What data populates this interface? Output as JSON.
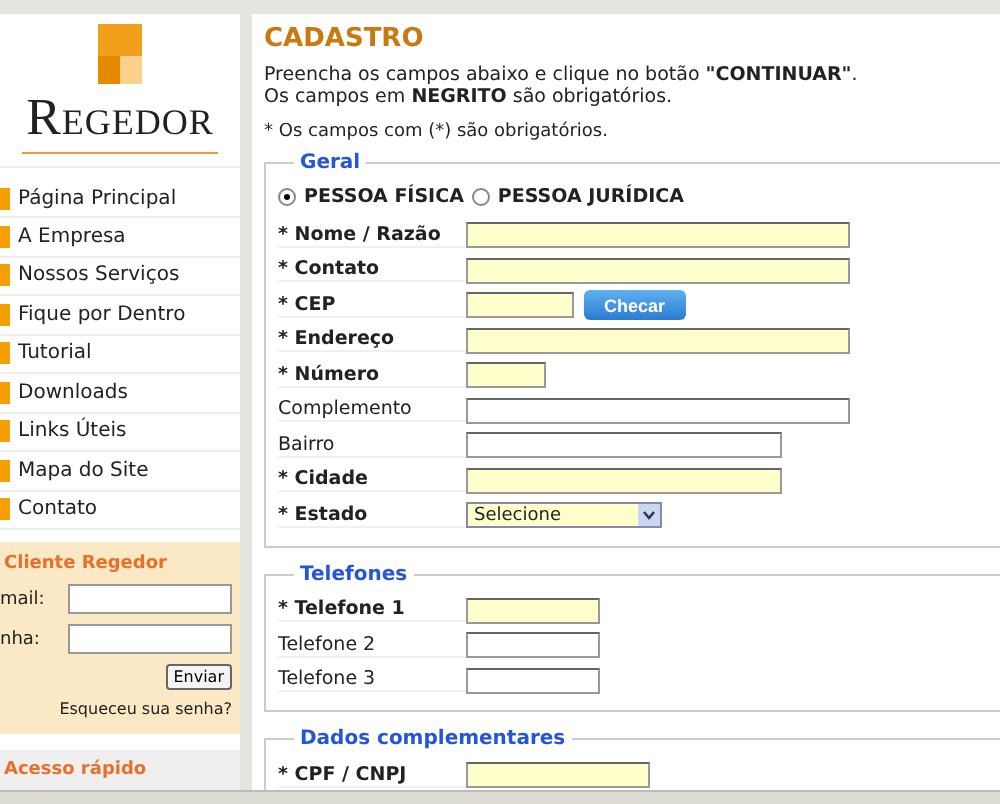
{
  "logo": {
    "text": "Regedor"
  },
  "menu": [
    {
      "label": "Página Principal"
    },
    {
      "label": "A Empresa"
    },
    {
      "label": "Nossos Serviços"
    },
    {
      "label": "Fique por Dentro"
    },
    {
      "label": "Tutorial"
    },
    {
      "label": "Downloads"
    },
    {
      "label": "Links Úteis"
    },
    {
      "label": "Mapa do Site"
    },
    {
      "label": "Contato"
    }
  ],
  "client_login": {
    "title": "Cliente Regedor",
    "fields": [
      {
        "label": "mail:"
      },
      {
        "label": "nha:"
      }
    ],
    "button": "Enviar",
    "forgot_link": "Esqueceu sua senha?"
  },
  "quick_access": {
    "title": "Acesso rápido"
  },
  "page": {
    "title": "CADASTRO",
    "intro": "Preencha os campos abaixo e clique no botão **\"CONTINUAR\"**.",
    "intro2": "Os campos em **NEGRITO** são obrigatórios.",
    "note": "* Os campos com (*) são obrigatórios."
  },
  "sections": [
    {
      "title": "Geral",
      "person_types": [
        {
          "label": "PESSOA FÍSICA",
          "selected": true
        },
        {
          "label": "PESSOA JURÍDICA",
          "selected": false
        }
      ],
      "fields": [
        {
          "label": "* Nome / Razão",
          "required": true,
          "kind": "text"
        },
        {
          "label": "* Contato",
          "required": true,
          "kind": "text"
        },
        {
          "label": "* CEP",
          "required": true,
          "kind": "text",
          "button": "Checar"
        },
        {
          "label": "* Endereço",
          "required": true,
          "kind": "text"
        },
        {
          "label": "* Número",
          "required": true,
          "kind": "text"
        },
        {
          "label": "Complemento",
          "required": false,
          "kind": "text"
        },
        {
          "label": "Bairro",
          "required": false,
          "kind": "text"
        },
        {
          "label": "* Cidade",
          "required": true,
          "kind": "text"
        },
        {
          "label": "* Estado",
          "required": true,
          "kind": "select",
          "value": "Selecione"
        }
      ]
    },
    {
      "title": "Telefones",
      "fields": [
        {
          "label": "* Telefone 1",
          "required": true,
          "kind": "text"
        },
        {
          "label": "Telefone 2",
          "required": false,
          "kind": "text"
        },
        {
          "label": "Telefone 3",
          "required": false,
          "kind": "text"
        }
      ]
    },
    {
      "title": "Dados complementares",
      "fields": [
        {
          "label": "* CPF / CNPJ",
          "required": true,
          "kind": "text"
        }
      ]
    }
  ]
}
